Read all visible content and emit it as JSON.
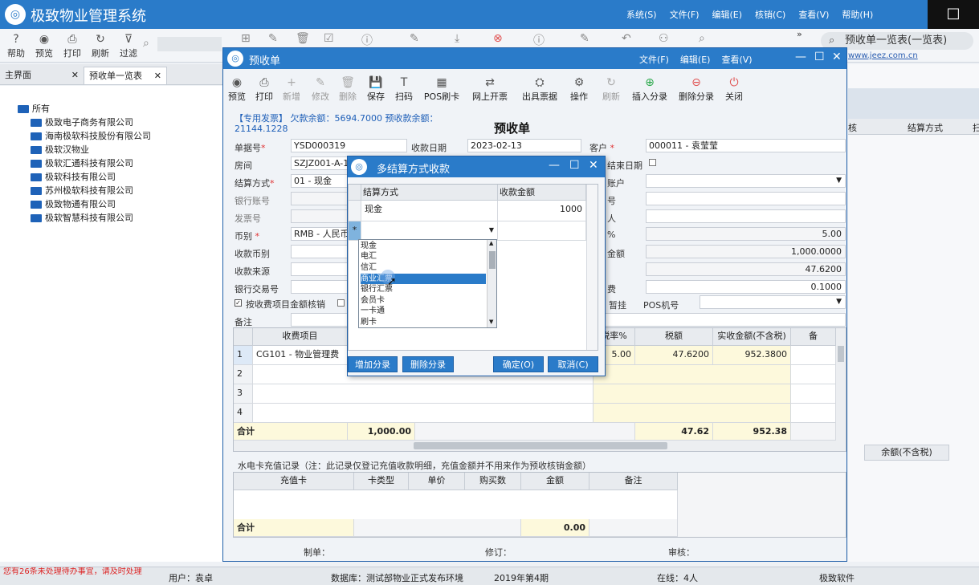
{
  "app": {
    "title": "极致物业管理系统",
    "menus": [
      "系统(S)",
      "文件(F)",
      "编辑(E)",
      "核销(C)",
      "查看(V)",
      "帮助(H)"
    ],
    "window_button": "□"
  },
  "main_toolbar": {
    "buttons": [
      {
        "label": "帮助",
        "icon": "?"
      },
      {
        "label": "预览",
        "icon": "◉"
      },
      {
        "label": "打印",
        "icon": "⎙"
      },
      {
        "label": "刷新",
        "icon": "↻"
      },
      {
        "label": "过滤",
        "icon": "⊽"
      }
    ],
    "search_text": "预收单一览表(一览表)",
    "url_hint": "www.jeez.com.cn"
  },
  "tabs": [
    {
      "label": "主界面"
    },
    {
      "label": "预收单一览表"
    }
  ],
  "tree": {
    "root": "所有",
    "items": [
      "极致电子商务有限公司",
      "海南极软科技股份有限公司",
      "极软汉物业",
      "极软汇通科技有限公司",
      "极软科技有限公司",
      "苏州极软科技有限公司",
      "极致物通有限公司",
      "极软智慧科技有限公司"
    ]
  },
  "right_bg": {
    "col_headers": [
      "核",
      "结算方式",
      "扫"
    ],
    "bottom_header": "余额(不含税)"
  },
  "receipt": {
    "window_title": "预收单",
    "menus": [
      "文件(F)",
      "编辑(E)",
      "查看(V)"
    ],
    "toolbar": [
      {
        "label": "预览",
        "icon": "◉",
        "enabled": true
      },
      {
        "label": "打印",
        "icon": "⎙",
        "enabled": true
      },
      {
        "label": "新增",
        "icon": "+",
        "enabled": false
      },
      {
        "label": "修改",
        "icon": "✎",
        "enabled": false
      },
      {
        "label": "删除",
        "icon": "🗑",
        "enabled": false
      },
      {
        "label": "保存",
        "icon": "💾",
        "enabled": true
      },
      {
        "label": "扫码",
        "icon": "T",
        "enabled": true
      },
      {
        "label": "POS刷卡",
        "icon": "▦",
        "enabled": true
      },
      {
        "label": "网上开票",
        "icon": "⇄",
        "enabled": true
      },
      {
        "label": "出具票据",
        "icon": "⛭",
        "enabled": true
      },
      {
        "label": "操作",
        "icon": "⚙",
        "enabled": true
      },
      {
        "label": "刷新",
        "icon": "↻",
        "enabled": false
      },
      {
        "label": "插入分录",
        "icon": "⊕",
        "enabled": true
      },
      {
        "label": "删除分录",
        "icon": "⊖",
        "enabled": true
      },
      {
        "label": "关闭",
        "icon": "⏻",
        "enabled": true
      }
    ],
    "invoice_note": "【专用发票】 欠款余额：5694.7000 预收款余额：",
    "invoice_amount": "21144.1228",
    "heading": "预收单",
    "fields": {
      "doc_no_label": "单据号",
      "doc_no": "YSD000319",
      "date_label": "收款日期",
      "date": "2023-02-13",
      "customer_label": "客户",
      "customer": "000011 - 袁莹莹",
      "room_label": "房间",
      "room": "SZJZ001-A-1",
      "end_date_label": "结束日期",
      "settle_label": "结算方式",
      "settle": "01 - 现金",
      "account_label": "账户",
      "bank_label": "银行账号",
      "no_label": "号",
      "invoice_label": "发票号",
      "person_label": "人",
      "currency_label": "币别",
      "currency": "RMB - 人民币",
      "pct_label": "%",
      "pct": "5.00",
      "recv_currency_label": "收款币别",
      "amount_label": "金额",
      "amount": "1,000.0000",
      "source_label": "收款来源",
      "tax_value": "47.6200",
      "bank_tx_label": "银行交易号",
      "fee_label": "费",
      "fee": "0.1000",
      "check_label": "按收费项目金额核销",
      "hold_label": "暂挂",
      "pos_label": "POS机号",
      "remark_label": "备注"
    },
    "grid": {
      "headers": [
        "收费项目",
        "税率%",
        "税额",
        "实收金额(不含税)",
        "备"
      ],
      "rows": [
        {
          "no": "1",
          "item": "CG101 - 物业管理费",
          "rate": "5.00",
          "tax": "47.6200",
          "net": "952.3800"
        },
        {
          "no": "2",
          "item": "",
          "rate": "",
          "tax": "",
          "net": ""
        },
        {
          "no": "3",
          "item": "",
          "rate": "",
          "tax": "",
          "net": ""
        },
        {
          "no": "4",
          "item": "",
          "rate": "",
          "tax": "",
          "net": ""
        }
      ],
      "total_label": "合计",
      "total_amount": "1,000.00",
      "total_tax": "47.62",
      "total_net": "952.38"
    },
    "card_note": "水电卡充值记录（注：此记录仅登记充值收款明细，充值金额并不用来作为预收核销金额）",
    "card_grid": {
      "headers": [
        "充值卡",
        "卡类型",
        "单价",
        "购买数",
        "金额",
        "备注"
      ],
      "total_label": "合计",
      "total_amount": "0.00"
    },
    "footer": {
      "maker_label": "制单：",
      "revise_label": "修订：",
      "audit_label": "审核："
    }
  },
  "dialog": {
    "title": "多结算方式收款",
    "headers": [
      "结算方式",
      "收款金额"
    ],
    "rows": [
      {
        "method": "现金",
        "amount": "1000"
      }
    ],
    "new_row_marker": "*",
    "dropdown_options": [
      "现金",
      "电汇",
      "信汇",
      "商业汇票",
      "银行汇票",
      "会员卡",
      "一卡通",
      "刷卡"
    ],
    "selected_option": "商业汇票",
    "buttons": {
      "add": "增加分录",
      "delete": "删除分录",
      "ok": "确定(O)",
      "cancel": "取消(C)"
    }
  },
  "statusbar": {
    "todo": "您有26条未处理待办事宜，请及时处理",
    "user": "用户：袁卓",
    "db": "数据库：测试部物业正式发布环境",
    "period": "2019年第4期",
    "online": "在线：4人",
    "vendor": "极致软件"
  }
}
